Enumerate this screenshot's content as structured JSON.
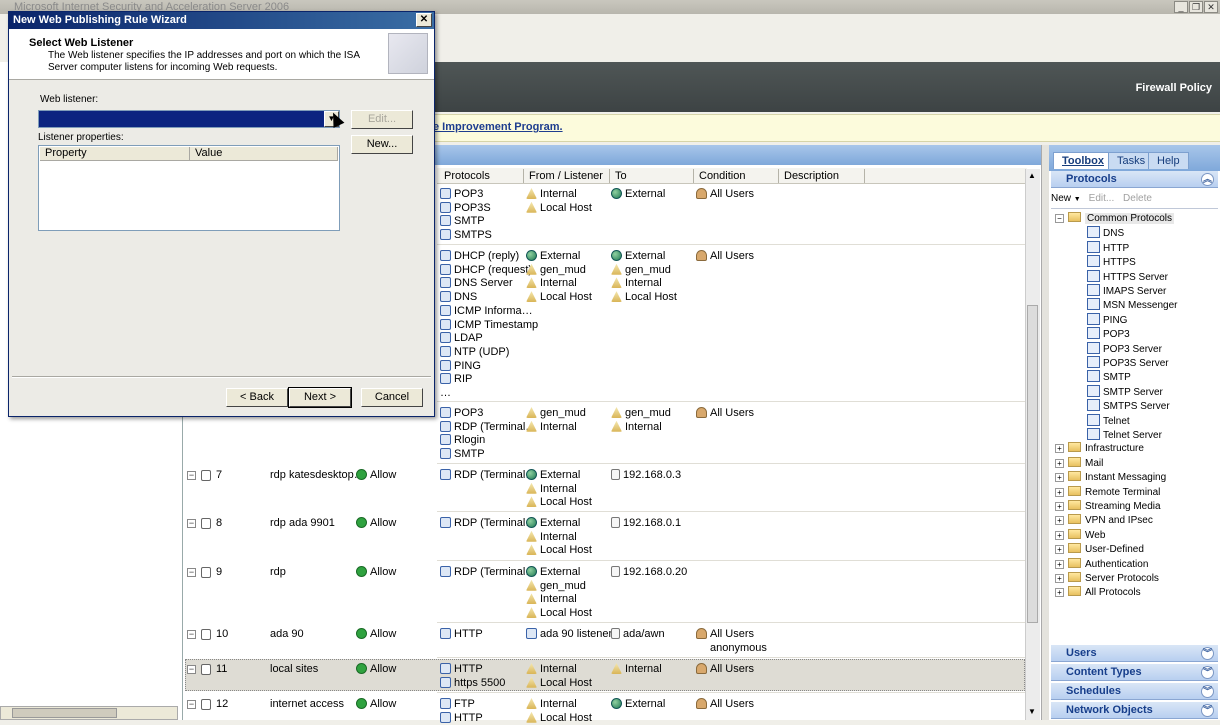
{
  "app": {
    "title": "Microsoft Internet Security and Acceleration Server 2006"
  },
  "header": {
    "section": "Firewall Policy",
    "banner_link": "e Improvement Program."
  },
  "grid": {
    "columns": [
      "Protocols",
      "From / Listener",
      "To",
      "Condition",
      "Description"
    ],
    "rows": [
      {
        "num": "",
        "name": "",
        "action": "",
        "protocols": [
          "POP3",
          "POP3S",
          "SMTP",
          "SMTPS"
        ],
        "from": [
          "Internal",
          "Local Host"
        ],
        "to": [
          "External"
        ],
        "condition": [
          "All Users"
        ]
      },
      {
        "num": "",
        "name": "",
        "action": "",
        "protocols": [
          "DHCP (reply)",
          "DHCP (request)",
          "DNS Server",
          "DNS",
          "ICMP Informa…",
          "ICMP Timestamp",
          "LDAP",
          "NTP (UDP)",
          "PING",
          "RIP",
          "…"
        ],
        "from": [
          "External",
          "gen_mud",
          "Internal",
          "Local Host"
        ],
        "to": [
          "External",
          "gen_mud",
          "Internal",
          "Local Host"
        ],
        "condition": [
          "All Users"
        ]
      },
      {
        "num": "",
        "name": "",
        "action": "",
        "protocols": [
          "POP3",
          "RDP (Terminal…",
          "Rlogin",
          "SMTP"
        ],
        "from": [
          "gen_mud",
          "Internal"
        ],
        "to": [
          "gen_mud",
          "Internal"
        ],
        "condition": [
          "All Users"
        ]
      },
      {
        "num": "7",
        "name": "rdp katesdesktop…",
        "action": "Allow",
        "protocols": [
          "RDP (Terminal…"
        ],
        "from": [
          "External",
          "Internal",
          "Local Host"
        ],
        "to": [
          "192.168.0.3"
        ],
        "condition": []
      },
      {
        "num": "8",
        "name": "rdp ada 9901",
        "action": "Allow",
        "protocols": [
          "RDP (Terminal…"
        ],
        "from": [
          "External",
          "Internal",
          "Local Host"
        ],
        "to": [
          "192.168.0.1"
        ],
        "condition": []
      },
      {
        "num": "9",
        "name": "rdp",
        "action": "Allow",
        "protocols": [
          "RDP (Terminal…"
        ],
        "from": [
          "External",
          "gen_mud",
          "Internal",
          "Local Host"
        ],
        "to": [
          "192.168.0.20"
        ],
        "condition": []
      },
      {
        "num": "10",
        "name": "ada 90",
        "action": "Allow",
        "protocols": [
          "HTTP"
        ],
        "from": [
          "ada 90 listener"
        ],
        "to": [
          "ada/awn"
        ],
        "condition": [
          "All Users",
          "anonymous"
        ]
      },
      {
        "num": "11",
        "name": "local sites",
        "action": "Allow",
        "protocols": [
          "HTTP",
          "https 5500"
        ],
        "from": [
          "Internal",
          "Local Host"
        ],
        "to": [
          "Internal"
        ],
        "condition": [
          "All Users"
        ]
      },
      {
        "num": "12",
        "name": "internet access",
        "action": "Allow",
        "protocols": [
          "FTP",
          "HTTP"
        ],
        "from": [
          "Internal",
          "Local Host"
        ],
        "to": [
          "External"
        ],
        "condition": [
          "All Users"
        ]
      }
    ]
  },
  "toolbox": {
    "tabs": [
      "Toolbox",
      "Tasks",
      "Help"
    ],
    "protocols_header": "Protocols",
    "toolbar": {
      "new": "New",
      "edit": "Edit...",
      "delete": "Delete"
    },
    "common_folder": "Common Protocols",
    "common_items": [
      "DNS",
      "HTTP",
      "HTTPS",
      "HTTPS Server",
      "IMAPS Server",
      "MSN Messenger",
      "PING",
      "POP3",
      "POP3 Server",
      "POP3S Server",
      "SMTP",
      "SMTP Server",
      "SMTPS Server",
      "Telnet",
      "Telnet Server"
    ],
    "folders": [
      "Infrastructure",
      "Mail",
      "Instant Messaging",
      "Remote Terminal",
      "Streaming Media",
      "VPN and IPsec",
      "Web",
      "User-Defined",
      "Authentication",
      "Server Protocols",
      "All Protocols"
    ],
    "sections": [
      "Users",
      "Content Types",
      "Schedules",
      "Network Objects"
    ]
  },
  "dialog": {
    "title": "New Web Publishing Rule Wizard",
    "heading": "Select Web Listener",
    "description": "The Web listener specifies the IP addresses and port on which the ISA Server computer listens for incoming Web requests.",
    "listener_label": "Web listener:",
    "listener_value": "",
    "edit_button": "Edit...",
    "new_button": "New...",
    "props_label": "Listener properties:",
    "props_columns": [
      "Property",
      "Value"
    ],
    "back_button": "< Back",
    "next_button": "Next >",
    "cancel_button": "Cancel"
  }
}
